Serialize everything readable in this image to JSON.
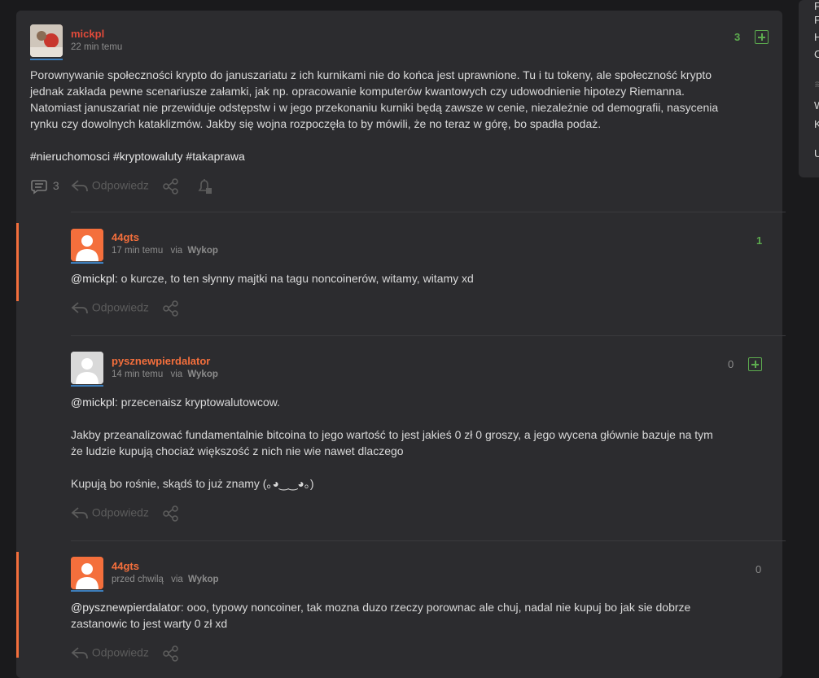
{
  "sidebar_fragment": {
    "lines": [
      "F",
      "F",
      "H",
      "C",
      "W",
      "K",
      "U"
    ]
  },
  "main_post": {
    "author": "mickpl",
    "time": "22 min temu",
    "score": "3",
    "body_lines": [
      "Porownywanie społeczności krypto do januszariatu z ich kurnikami nie do końca jest uprawnione. Tu i tu tokeny, ale społeczność krypto",
      "jednak zakłada pewne scenariusze załamki, jak np. opracowanie komputerów kwantowych czy udowodnienie hipotezy Riemanna.",
      "Natomiast januszariat nie przewiduje odstępstw i w jego przekonaniu kurniki będą zawsze w cenie, niezależnie od demografii, nasycenia",
      "rynku czy dowolnych kataklizmów. Jakby się wojna rozpoczęła to by mówili, że no teraz w górę, bo spadła podaż."
    ],
    "tags": "#nieruchomosci #kryptowaluty #takaprawa",
    "comments_count": "3",
    "reply_label": "Odpowiedz",
    "colors": {
      "author": "#e04a3a",
      "score": "#5dac4f"
    }
  },
  "comments": [
    {
      "author": "44gts",
      "time": "17 min temu",
      "via_label": "via",
      "via": "Wykop",
      "score": "1",
      "mention": "@mickpl",
      "text_lines": [
        ": o kurcze, to ten słynny majtki na tagu noncoinerów, witamy, witamy xd"
      ],
      "reply_label": "Odpowiedz"
    },
    {
      "author": "pysznewpierdalator",
      "time": "14 min temu",
      "via_label": "via",
      "via": "Wykop",
      "score": "0",
      "mention": "@mickpl",
      "text_lines": [
        ": przecenaisz kryptowalutowcow.",
        "Jakby przeanalizować fundamentalnie bitcoina to jego wartość to jest jakieś 0 zł 0 groszy, a jego wycena głównie bazuje na tym",
        "że ludzie kupują chociaż większość z nich nie wie nawet dlaczego",
        "Kupują bo rośnie, skądś to już znamy (｡◕‿‿◕｡)"
      ],
      "reply_label": "Odpowiedz"
    },
    {
      "author": "44gts",
      "time": "przed chwilą",
      "via_label": "via",
      "via": "Wykop",
      "score": "0",
      "mention": "@pysznewpierdalator",
      "text_lines": [
        ": ooo, typowy noncoiner, tak mozna duzo rzeczy porownac ale chuj, nadal nie kupuj bo jak sie dobrze",
        "zastanowic to jest warty 0 zł xd"
      ],
      "reply_label": "Odpowiedz"
    }
  ],
  "icons": {
    "comments": "comments-icon",
    "reply": "reply-arrow-icon",
    "share": "share-icon",
    "notify": "bell-icon",
    "plus": "plus-box-icon"
  },
  "colors": {
    "accent_orange": "#f46f3c",
    "comment_author": "#f46f3c",
    "green": "#5dac4f",
    "card_bg": "#2c2c2f",
    "page_bg": "#1a1a1c"
  }
}
